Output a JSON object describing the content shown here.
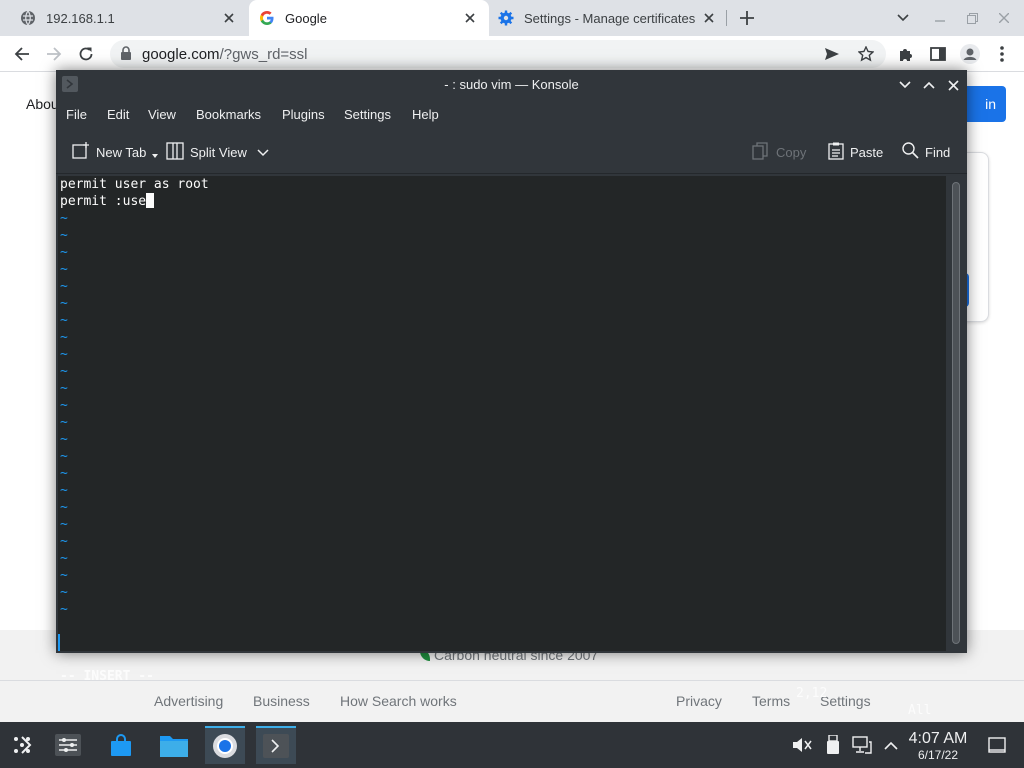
{
  "browser": {
    "tabs": [
      {
        "title": "192.168.1.1",
        "icon": "globe-icon",
        "active": false
      },
      {
        "title": "Google",
        "icon": "google-icon",
        "active": true
      },
      {
        "title": "Settings - Manage certificates",
        "icon": "gear-icon",
        "active": false
      }
    ],
    "url_host": "google.com",
    "url_rest": "/?gws_rd=ssl"
  },
  "page": {
    "about": "Abou",
    "signin": "in",
    "carbon": "Carbon neutral since 2007",
    "footer_links": [
      "Advertising",
      "Business",
      "How Search works",
      "Privacy",
      "Terms",
      "Settings"
    ]
  },
  "konsole": {
    "title": "- : sudo vim — Konsole",
    "menu": [
      "File",
      "Edit",
      "View",
      "Bookmarks",
      "Plugins",
      "Settings",
      "Help"
    ],
    "toolbar": {
      "new_tab": "New Tab",
      "split_view": "Split View",
      "copy": "Copy",
      "paste": "Paste",
      "find": "Find"
    },
    "lines": [
      "permit user as root",
      "permit :use"
    ],
    "tilde": "~",
    "status": {
      "mode": "-- INSERT --",
      "position": "2,12",
      "scroll": "All"
    }
  },
  "taskbar": {
    "time": "4:07 AM",
    "date": "6/17/22"
  },
  "colors": {
    "konsole_bg": "#31363b",
    "terminal_bg": "#232627",
    "tilde": "#1d99f3",
    "accent": "#1a73e8"
  }
}
